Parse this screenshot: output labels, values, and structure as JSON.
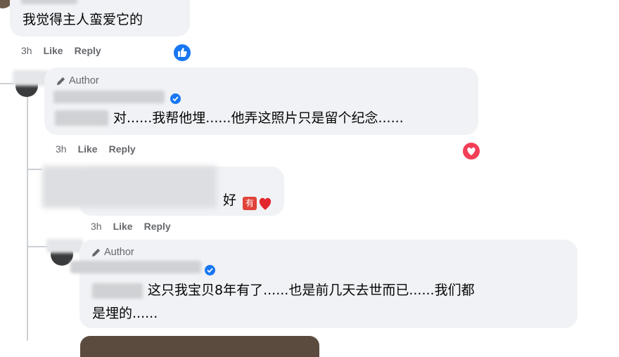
{
  "comments": [
    {
      "text": "我觉得主人蛮爱它的",
      "time": "3h",
      "like_label": "Like",
      "reply_label": "Reply",
      "reaction": "like-icon"
    },
    {
      "author_badge": "Author",
      "text": "对......我帮他埋......他弄这照片只是留个纪念......",
      "time": "3h",
      "like_label": "Like",
      "reply_label": "Reply",
      "reaction": "love-icon"
    },
    {
      "text": "好",
      "emoji_badge": "有",
      "time": "3h",
      "like_label": "Like",
      "reply_label": "Reply"
    },
    {
      "author_badge": "Author",
      "text_line1": "这只我宝贝8年有了......也是前几天去世而已......我们都",
      "text_line2": "是埋的......"
    }
  ],
  "colors": {
    "bubble": "#f0f2f5",
    "meta_text": "#65676b",
    "like_blue": "#1877f2",
    "love_red": "#f33e58",
    "verified_blue": "#1877f2"
  }
}
